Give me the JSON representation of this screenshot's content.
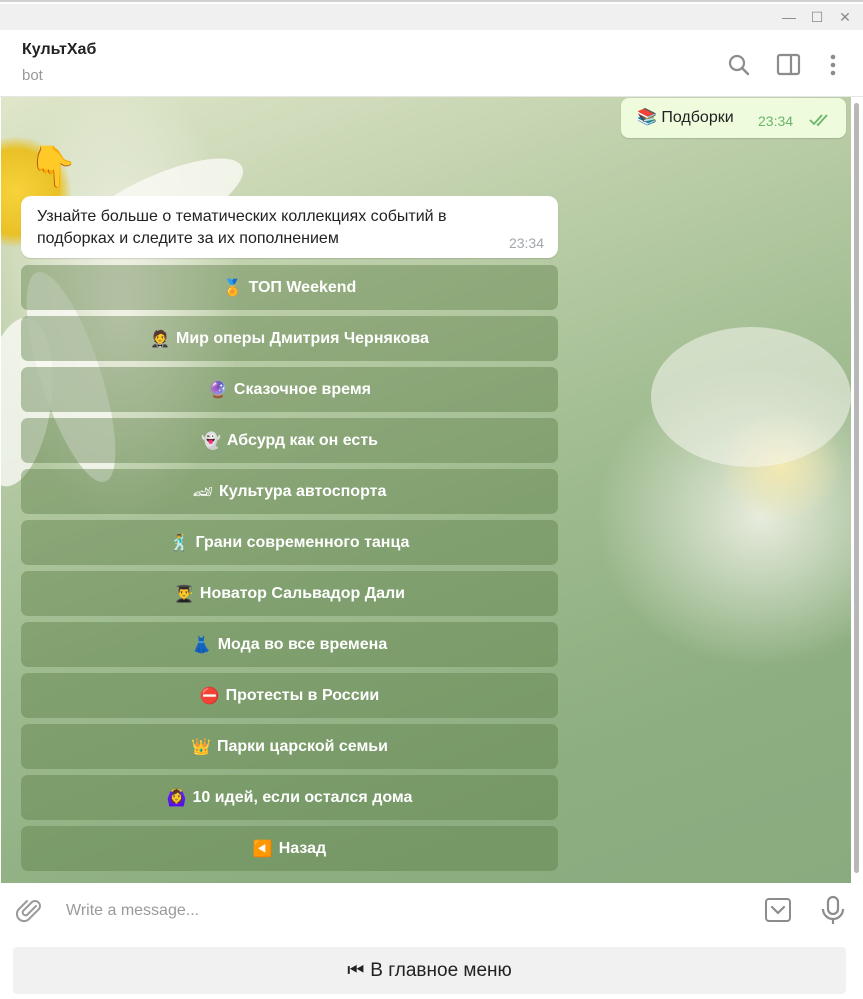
{
  "window": {
    "minimize_glyph": "—",
    "maximize_glyph": "☐",
    "close_glyph": "✕"
  },
  "header": {
    "title": "КультХаб",
    "subtitle": "bot",
    "icons": [
      "search-icon",
      "sidebar-toggle-icon",
      "more-vertical-icon"
    ]
  },
  "outgoing_message": {
    "emoji": "📚",
    "text": "Подборки",
    "time": "23:34",
    "status": "read"
  },
  "sticker_emoji": "👇",
  "incoming_message": {
    "text": "Узнайте больше о тематических коллекциях событий в подборках и следите за их пополнением",
    "time": "23:34"
  },
  "inline_keyboard": [
    {
      "emoji": "🏅",
      "label": "ТОП Weekend"
    },
    {
      "emoji": "🤵",
      "label": "Мир оперы Дмитрия Чернякова"
    },
    {
      "emoji": "🔮",
      "label": "Сказочное время"
    },
    {
      "emoji": "👻",
      "label": "Абсурд как он есть"
    },
    {
      "emoji": "🏎",
      "label": "Культура автоспорта"
    },
    {
      "emoji": "🕺",
      "label": "Грани современного танца"
    },
    {
      "emoji": "👨‍🎓",
      "label": "Новатор Сальвадор Дали"
    },
    {
      "emoji": "👗",
      "label": "Мода во все времена"
    },
    {
      "emoji": "⛔",
      "label": "Протесты в России"
    },
    {
      "emoji": "👑",
      "label": "Парки царской семьи"
    },
    {
      "emoji": "🙆‍♀️",
      "label": "10 идей, если остался дома"
    },
    {
      "emoji": "◀️",
      "label": "Назад"
    }
  ],
  "composer": {
    "placeholder": "Write a message..."
  },
  "reply_keyboard": {
    "emoji": "⏮",
    "label": "В главное меню"
  },
  "colors": {
    "outgoing_bubble": "#eefcdd",
    "read_check": "#6ab56a",
    "inline_button": "#5a7d46"
  }
}
